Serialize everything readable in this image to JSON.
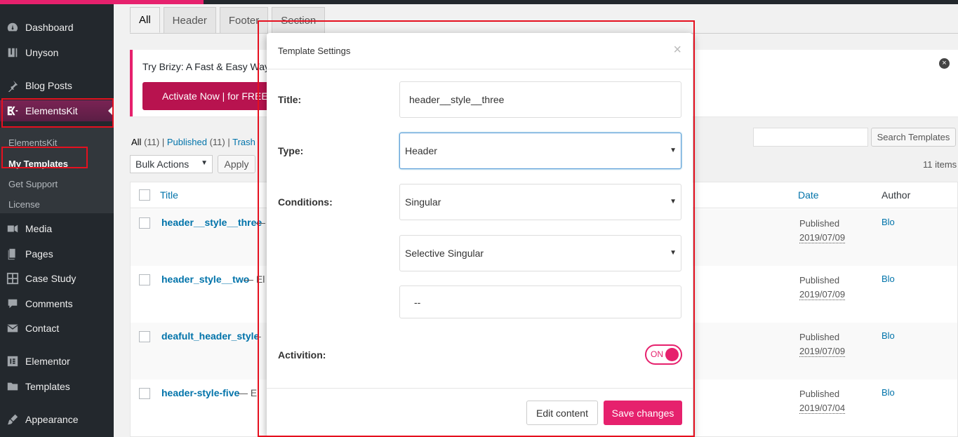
{
  "sidebar": {
    "items": [
      {
        "label": "Dashboard",
        "icon": "dashboard-icon"
      },
      {
        "label": "Unyson",
        "icon": "unyson-icon"
      },
      {
        "label": "Blog Posts",
        "icon": "pushpin-icon"
      },
      {
        "label": "ElementsKit",
        "icon": "elementskit-icon"
      },
      {
        "label": "Media",
        "icon": "media-icon"
      },
      {
        "label": "Pages",
        "icon": "pages-icon"
      },
      {
        "label": "Case Study",
        "icon": "grid-icon"
      },
      {
        "label": "Comments",
        "icon": "comment-icon"
      },
      {
        "label": "Contact",
        "icon": "mail-icon"
      },
      {
        "label": "Elementor",
        "icon": "elementor-icon"
      },
      {
        "label": "Templates",
        "icon": "folder-icon"
      },
      {
        "label": "Appearance",
        "icon": "brush-icon"
      }
    ],
    "submenu": [
      "ElementsKit",
      "My Templates",
      "Get Support",
      "License"
    ]
  },
  "tabs": [
    "All",
    "Header",
    "Footer",
    "Section"
  ],
  "notice": {
    "text": "Try Brizy: A Fast & Easy Way",
    "button": "Activate Now | for FREE",
    "close": "×"
  },
  "filters": {
    "all": "All",
    "all_count": "(11)",
    "published": "Published",
    "published_count": "(11)",
    "trash": "Trash"
  },
  "bulk_actions": "Bulk Actions",
  "apply": "Apply",
  "search_button": "Search Templates",
  "items_count": "11 items",
  "table": {
    "headers": {
      "title": "Title",
      "date": "Date",
      "author": "Author"
    },
    "rows": [
      {
        "title": "header__style__three",
        "suffix": " —",
        "status": "Published",
        "date": "2019/07/09",
        "author": "Blo"
      },
      {
        "title": "header_style__two",
        "suffix": " — El",
        "status": "Published",
        "date": "2019/07/09",
        "author": "Blo"
      },
      {
        "title": "deafult_header_style",
        "suffix": " –",
        "status": "Published",
        "date": "2019/07/09",
        "author": "Blo"
      },
      {
        "title": "header-style-five",
        "suffix": " — El",
        "status": "Published",
        "date": "2019/07/04",
        "author": "Blo"
      }
    ]
  },
  "modal": {
    "title": "Template Settings",
    "close": "×",
    "title_label": "Title:",
    "title_value": "header__style__three",
    "type_label": "Type:",
    "type_value": "Header",
    "conditions_label": "Conditions:",
    "conditions_value": "Singular",
    "singular_value": "Selective Singular",
    "selector_value": "--",
    "activation_label": "Activition:",
    "toggle_text": "ON",
    "edit_button": "Edit content",
    "save_button": "Save changes"
  },
  "colors": {
    "accent": "#e6216d",
    "link": "#0073aa",
    "sidebar": "#23282d",
    "highlight": "#e5101f"
  }
}
